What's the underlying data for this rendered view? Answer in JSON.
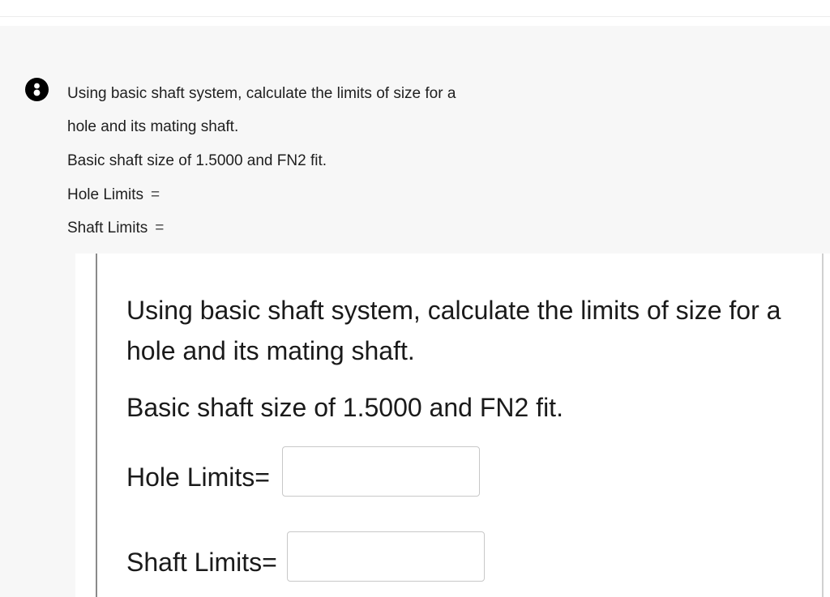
{
  "question": {
    "step_icon": "step-marker-icon",
    "line1": "Using basic shaft system, calculate the limits of size for a",
    "line2": "hole and its mating shaft.",
    "line3": "Basic shaft size of 1.5000 and FN2 fit.",
    "hole_label": "Hole Limits",
    "shaft_label": "Shaft Limits",
    "equals": "="
  },
  "image_panel": {
    "line1": "Using basic shaft system, calculate the limits of size for a",
    "line2": "hole and its mating shaft.",
    "line3": "Basic shaft size of 1.5000 and FN2 fit.",
    "hole_label": "Hole Limits=",
    "hole_value": "",
    "shaft_label": "Shaft Limits=",
    "shaft_value": ""
  }
}
